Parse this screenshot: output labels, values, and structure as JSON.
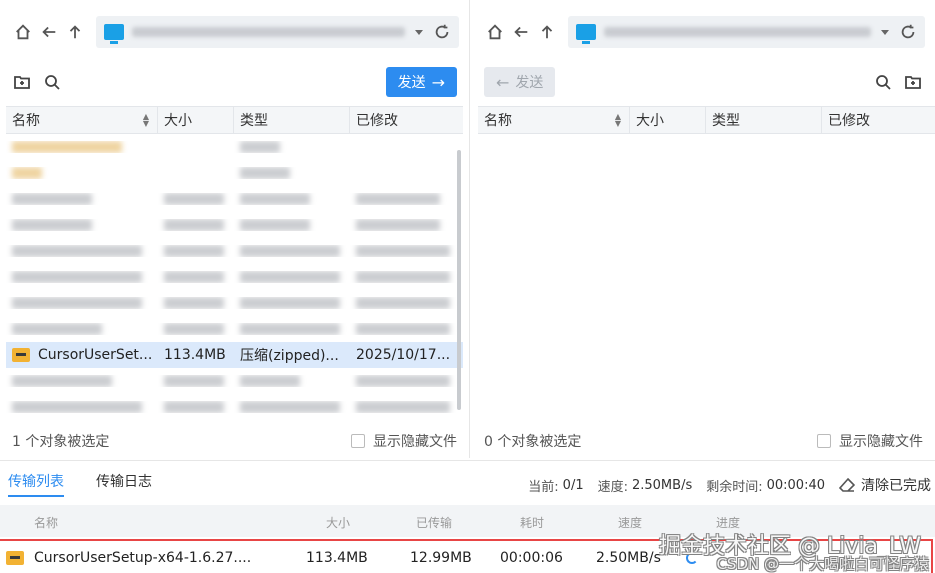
{
  "left_pane": {
    "send_label": "发送",
    "columns": [
      "名称",
      "大小",
      "类型",
      "已修改"
    ],
    "selected_row": {
      "name": "CursorUserSet...",
      "size": "113.4MB",
      "type": "压缩(zipped)...",
      "modified": "2025/10/17..."
    },
    "status": "1 个对象被选定",
    "show_hidden": "显示隐藏文件"
  },
  "right_pane": {
    "send_label": "发送",
    "columns": [
      "名称",
      "大小",
      "类型",
      "已修改"
    ],
    "status": "0 个对象被选定",
    "show_hidden": "显示隐藏文件"
  },
  "bottom": {
    "tabs": [
      "传输列表",
      "传输日志"
    ],
    "current_label": "当前:",
    "current_value": "0/1",
    "speed_label": "速度:",
    "speed_value": "2.50MB/s",
    "remaining_label": "剩余时间:",
    "remaining_value": "00:00:40",
    "clear_label": "清除已完成",
    "list_columns": [
      "名称",
      "大小",
      "已传输",
      "耗时",
      "速度",
      "进度"
    ],
    "transfer": {
      "name": "CursorUserSetup-x64-1.6.27....",
      "size": "113.4MB",
      "transferred": "12.99MB",
      "elapsed": "00:00:06",
      "speed": "2.50MB/s"
    }
  },
  "watermark": {
    "line1": "掘金技术社区 @ Livia_LW",
    "line2": "CSDN @一个大喝啦白可怪序猿"
  },
  "colors": {
    "accent": "#2d8cf0",
    "selected_row": "#dbe9fb",
    "highlight_border": "#e84545"
  }
}
